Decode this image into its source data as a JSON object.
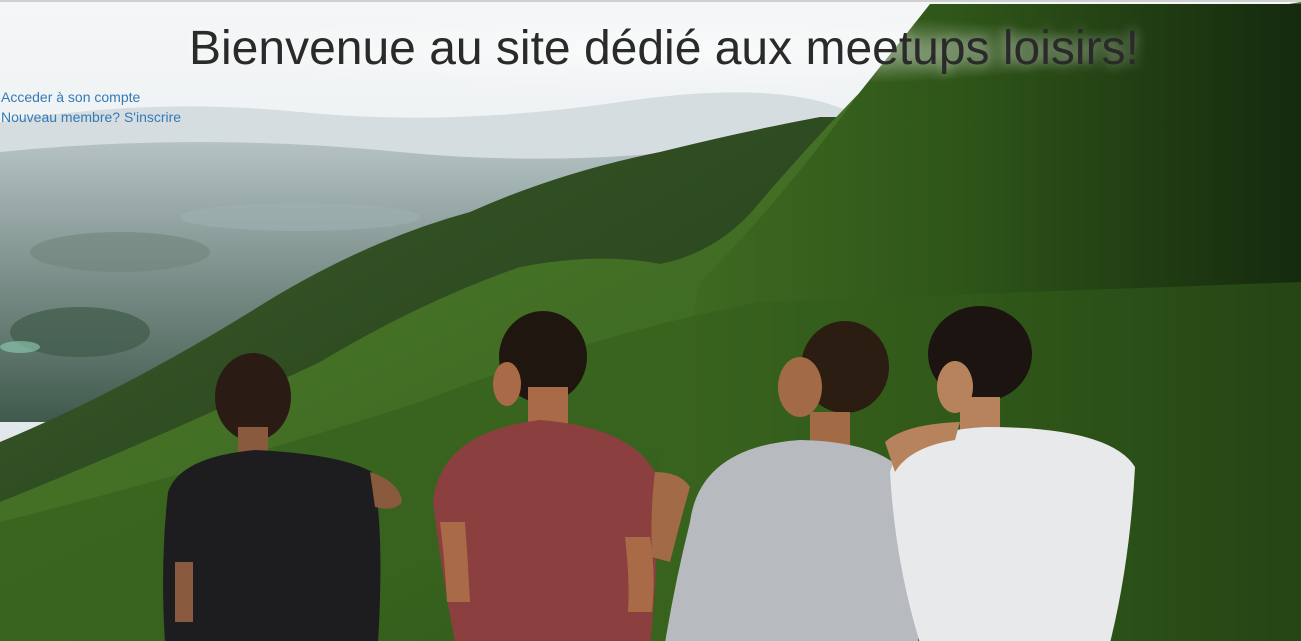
{
  "header": {
    "title": "Bienvenue au site dédié aux meetups loisirs!"
  },
  "nav": {
    "login_link": "Acceder à son compte",
    "signup_link": "Nouveau membre? S'inscrire"
  },
  "colors": {
    "link": "#337ab7",
    "title": "#2a2a2a"
  },
  "hero_image": {
    "icon": "photo-friends-on-mountain"
  }
}
